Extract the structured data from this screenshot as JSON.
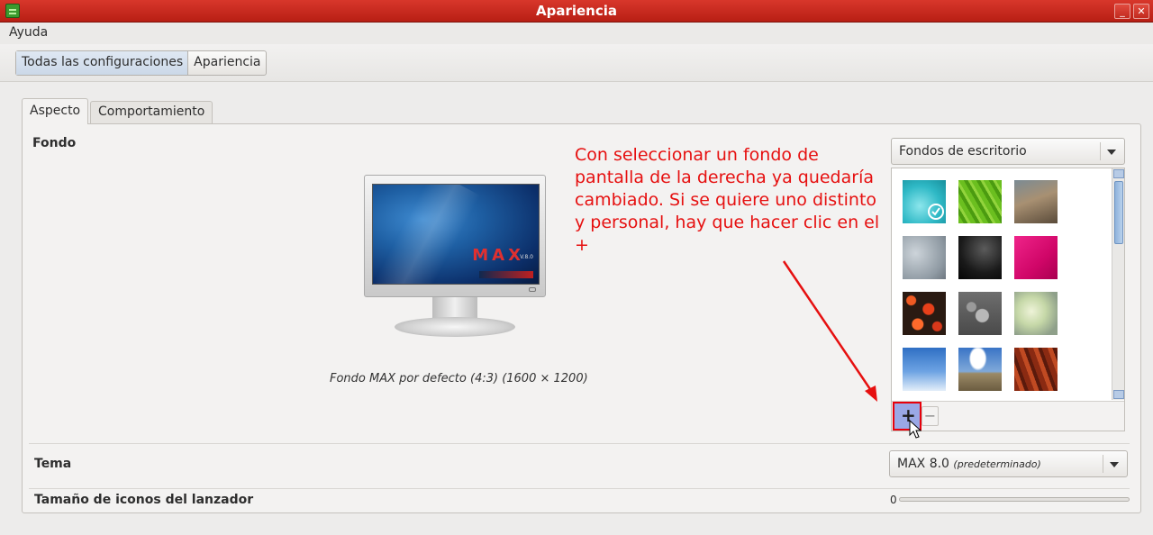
{
  "window": {
    "title": "Apariencia",
    "minimize_glyph": "_",
    "close_glyph": "✕"
  },
  "menu": {
    "help_label": "Ayuda"
  },
  "breadcrumb": {
    "items": [
      "Todas las configuraciones",
      "Apariencia"
    ]
  },
  "tabs": [
    {
      "label": "Aspecto",
      "selected": true
    },
    {
      "label": "Comportamiento",
      "selected": false
    }
  ],
  "background": {
    "section_label": "Fondo",
    "preview_caption": "Fondo MAX por defecto (4:3) (1600 × 1200)",
    "logo_text": "MAX",
    "logo_version": "V.8.0",
    "source_combo": "Fondos de escritorio",
    "add_label": "+",
    "remove_label": "−",
    "wallpapers": [
      {
        "name": "cyan-water",
        "selected": true
      },
      {
        "name": "green-leaf",
        "selected": false
      },
      {
        "name": "grass-macro",
        "selected": false
      },
      {
        "name": "grey-drops",
        "selected": false
      },
      {
        "name": "dark-feather",
        "selected": false
      },
      {
        "name": "magenta",
        "selected": false
      },
      {
        "name": "red-flowers",
        "selected": false
      },
      {
        "name": "water-drops",
        "selected": false
      },
      {
        "name": "soft-light",
        "selected": false
      },
      {
        "name": "blue-sky",
        "selected": false
      },
      {
        "name": "road-cloud",
        "selected": false
      },
      {
        "name": "red-canyon",
        "selected": false
      }
    ]
  },
  "annotation": {
    "text": "Con seleccionar un fondo de pantalla de la derecha ya quedaría cambiado. Si se quiere uno distinto y personal, hay que hacer clic en el +",
    "color": "#e61010"
  },
  "theme": {
    "section_label": "Tema",
    "value": "MAX 8.0",
    "value_note": "(predeterminado)"
  },
  "launcher": {
    "section_label": "Tamaño de iconos del lanzador",
    "value": "0"
  },
  "colors": {
    "titlebar": "#c62a1e",
    "accent_selection": "#9aa8e6",
    "highlight_border": "#e8000b"
  }
}
